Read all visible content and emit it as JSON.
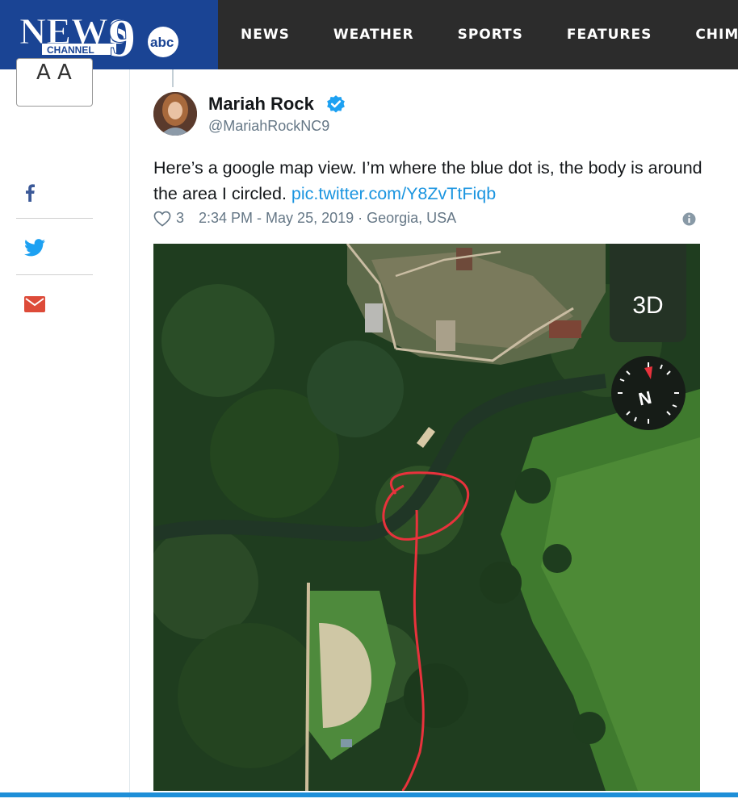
{
  "header": {
    "logo": {
      "brand_text": "NEWS",
      "sub_text": "CHANNEL",
      "number": "9",
      "network": "abc"
    },
    "nav": [
      "NEWS",
      "WEATHER",
      "SPORTS",
      "FEATURES",
      "CHIME IN"
    ]
  },
  "share": {
    "text_size_icon": "text-size-icon",
    "items": [
      {
        "name": "facebook",
        "icon": "facebook-icon",
        "color": "#3b5998"
      },
      {
        "name": "twitter",
        "icon": "twitter-icon",
        "color": "#1da1f2"
      },
      {
        "name": "email",
        "icon": "email-icon",
        "color": "#dd4b39"
      }
    ]
  },
  "tweet": {
    "author_name": "Mariah Rock",
    "handle": "@MariahRockNC9",
    "text": "Here’s a google map view. I’m where the blue dot is, the body is around the area I circled. ",
    "link": "pic.twitter.com/Y8ZvTtFiqb",
    "likes": "3",
    "timestamp": "2:34 PM - May 25, 2019 · Georgia, USA",
    "link_color": "#1b95e0"
  },
  "map": {
    "button_3d": "3D",
    "compass_label": "N",
    "annotation_color": "#e8323c"
  }
}
